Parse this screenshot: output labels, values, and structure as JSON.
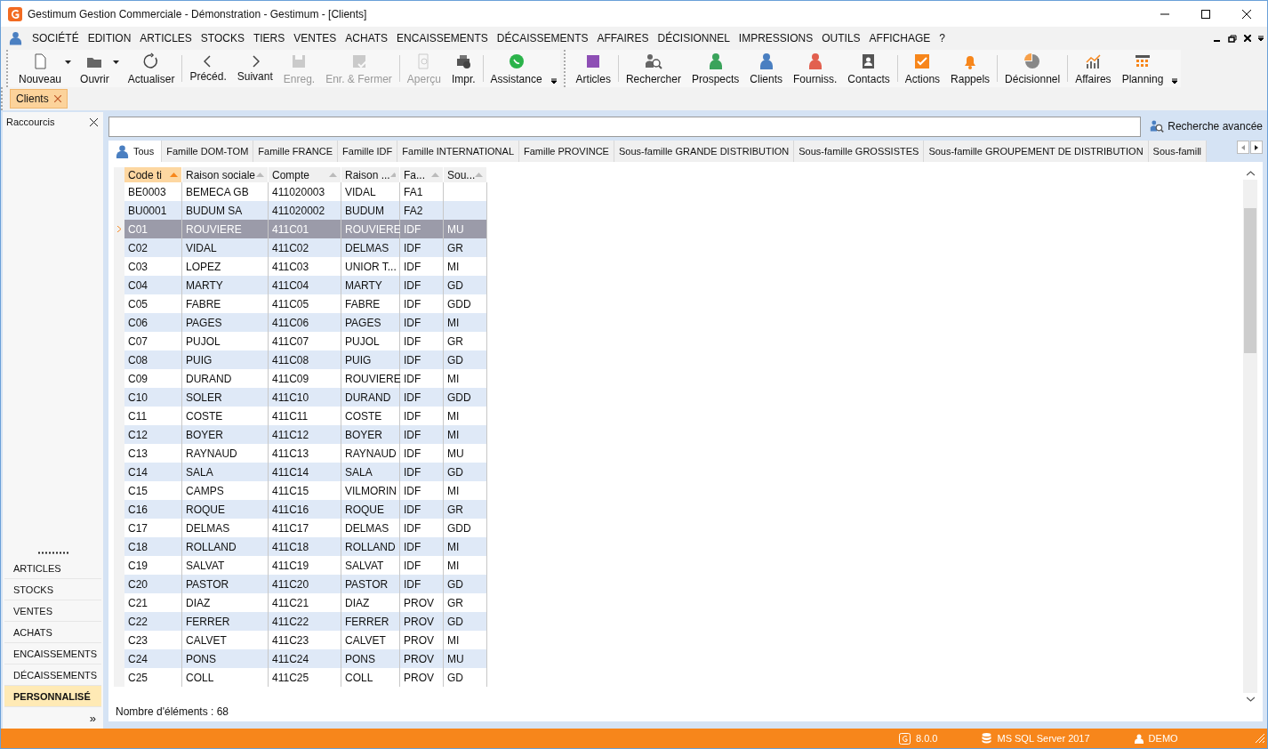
{
  "window": {
    "title": "Gestimum Gestion Commerciale - Démonstration - Gestimum - [Clients]"
  },
  "menu": [
    "SOCIÉTÉ",
    "EDITION",
    "ARTICLES",
    "STOCKS",
    "TIERS",
    "VENTES",
    "ACHATS",
    "ENCAISSEMENTS",
    "DÉCAISSEMENTS",
    "AFFAIRES",
    "DÉCISIONNEL",
    "IMPRESSIONS",
    "OUTILS",
    "AFFICHAGE",
    "?"
  ],
  "toolbars": [
    {
      "groups": [
        [
          {
            "label": "Nouveau",
            "kind": "new",
            "dropdown": true,
            "disabled": false
          },
          {
            "label": "Ouvrir",
            "kind": "folder",
            "dropdown": true,
            "disabled": false
          },
          {
            "label": "Actualiser",
            "kind": "refresh",
            "dropdown": false,
            "disabled": false
          }
        ],
        [
          {
            "label": "Précéd.",
            "kind": "prev",
            "dropdown": false,
            "disabled": false
          },
          {
            "label": "Suivant",
            "kind": "next",
            "dropdown": false,
            "disabled": false
          },
          {
            "label": "Enreg.",
            "kind": "save",
            "dropdown": false,
            "disabled": true
          },
          {
            "label": "Enr. & Fermer",
            "kind": "savecheck",
            "dropdown": false,
            "disabled": true
          }
        ],
        [
          {
            "label": "Aperçu",
            "kind": "preview",
            "dropdown": false,
            "disabled": true
          },
          {
            "label": "Impr.",
            "kind": "printer",
            "dropdown": false,
            "disabled": false
          }
        ],
        [
          {
            "label": "Assistance",
            "kind": "chat",
            "dropdown": false,
            "disabled": false
          }
        ]
      ]
    },
    {
      "groups": [
        [
          {
            "label": "Articles",
            "kind": "square",
            "dropdown": false,
            "disabled": false
          }
        ],
        [
          {
            "label": "Rechercher",
            "kind": "search",
            "dropdown": false,
            "disabled": false
          },
          {
            "label": "Prospects",
            "kind": "person",
            "color": "#3aa35b",
            "dropdown": false,
            "disabled": false
          },
          {
            "label": "Clients",
            "kind": "person",
            "color": "#4a7fc1",
            "dropdown": false,
            "disabled": false
          },
          {
            "label": "Fourniss.",
            "kind": "person",
            "color": "#e2604f",
            "dropdown": false,
            "disabled": false
          },
          {
            "label": "Contacts",
            "kind": "contacts",
            "dropdown": false,
            "disabled": false
          }
        ],
        [
          {
            "label": "Actions",
            "kind": "check",
            "dropdown": false,
            "disabled": false
          },
          {
            "label": "Rappels",
            "kind": "bell",
            "dropdown": false,
            "disabled": false
          }
        ],
        [
          {
            "label": "Décisionnel",
            "kind": "pie",
            "dropdown": false,
            "disabled": false
          }
        ],
        [
          {
            "label": "Affaires",
            "kind": "chart",
            "dropdown": false,
            "disabled": false
          },
          {
            "label": "Planning",
            "kind": "calendar",
            "dropdown": false,
            "disabled": false
          }
        ]
      ]
    }
  ],
  "document_tabs": [
    {
      "label": "Clients",
      "selected": true
    }
  ],
  "shortcuts": {
    "title": "Raccourcis",
    "items": [
      {
        "label": "ARTICLES",
        "selected": false
      },
      {
        "label": "STOCKS",
        "selected": false
      },
      {
        "label": "VENTES",
        "selected": false
      },
      {
        "label": "ACHATS",
        "selected": false
      },
      {
        "label": "ENCAISSEMENTS",
        "selected": false
      },
      {
        "label": "DÉCAISSEMENTS",
        "selected": false
      },
      {
        "label": "PERSONNALISÉ",
        "selected": true
      }
    ],
    "more": "»"
  },
  "search": {
    "button": "Recherche avancée"
  },
  "tabs": [
    {
      "label": "Tous",
      "selected": true
    },
    {
      "label": "Famille DOM-TOM",
      "selected": false
    },
    {
      "label": "Famille FRANCE",
      "selected": false
    },
    {
      "label": "Famille IDF",
      "selected": false
    },
    {
      "label": "Famille INTERNATIONAL",
      "selected": false
    },
    {
      "label": "Famille PROVINCE",
      "selected": false
    },
    {
      "label": "Sous-famille GRANDE DISTRIBUTION",
      "selected": false
    },
    {
      "label": "Sous-famille GROSSISTES",
      "selected": false
    },
    {
      "label": "Sous-famille GROUPEMENT DE DISTRIBUTION",
      "selected": false
    },
    {
      "label": "Sous-famill",
      "selected": false
    }
  ],
  "table": {
    "columns": [
      {
        "label": "Code ti",
        "sorted": true
      },
      {
        "label": "Raison sociale",
        "sorted": false
      },
      {
        "label": "Compte",
        "sorted": false
      },
      {
        "label": "Raison ...",
        "sorted": false
      },
      {
        "label": "Fa...",
        "sorted": false
      },
      {
        "label": "Sou...",
        "sorted": false
      }
    ],
    "rows": [
      {
        "cells": [
          "BE0003",
          "BEMECA GB",
          "411020003",
          "VIDAL",
          "FA1"
        ],
        "selected": false
      },
      {
        "cells": [
          "BU0001",
          "BUDUM SA",
          "411020002",
          "BUDUM",
          "FA2"
        ],
        "selected": false
      },
      {
        "cells": [
          "C01",
          "ROUVIERE",
          "411C01",
          "ROUVIERE",
          "IDF",
          "MU"
        ],
        "selected": true
      },
      {
        "cells": [
          "C02",
          "VIDAL",
          "411C02",
          "DELMAS",
          "IDF",
          "GR"
        ],
        "selected": false
      },
      {
        "cells": [
          "C03",
          "LOPEZ",
          "411C03",
          "UNIOR T...",
          "IDF",
          "MI"
        ],
        "selected": false
      },
      {
        "cells": [
          "C04",
          "MARTY",
          "411C04",
          "MARTY",
          "IDF",
          "GD"
        ],
        "selected": false
      },
      {
        "cells": [
          "C05",
          "FABRE",
          "411C05",
          "FABRE",
          "IDF",
          "GDD"
        ],
        "selected": false
      },
      {
        "cells": [
          "C06",
          "PAGES",
          "411C06",
          "PAGES",
          "IDF",
          "MI"
        ],
        "selected": false
      },
      {
        "cells": [
          "C07",
          "PUJOL",
          "411C07",
          "PUJOL",
          "IDF",
          "GR"
        ],
        "selected": false
      },
      {
        "cells": [
          "C08",
          "PUIG",
          "411C08",
          "PUIG",
          "IDF",
          "GD"
        ],
        "selected": false
      },
      {
        "cells": [
          "C09",
          "DURAND",
          "411C09",
          "ROUVIERE",
          "IDF",
          "MI"
        ],
        "selected": false
      },
      {
        "cells": [
          "C10",
          "SOLER",
          "411C10",
          "DURAND",
          "IDF",
          "GDD"
        ],
        "selected": false
      },
      {
        "cells": [
          "C11",
          "COSTE",
          "411C11",
          "COSTE",
          "IDF",
          "MI"
        ],
        "selected": false
      },
      {
        "cells": [
          "C12",
          "BOYER",
          "411C12",
          "BOYER",
          "IDF",
          "MI"
        ],
        "selected": false
      },
      {
        "cells": [
          "C13",
          "RAYNAUD",
          "411C13",
          "RAYNAUD",
          "IDF",
          "MU"
        ],
        "selected": false
      },
      {
        "cells": [
          "C14",
          "SALA",
          "411C14",
          "SALA",
          "IDF",
          "GD"
        ],
        "selected": false
      },
      {
        "cells": [
          "C15",
          "CAMPS",
          "411C15",
          "VILMORIN",
          "IDF",
          "MI"
        ],
        "selected": false
      },
      {
        "cells": [
          "C16",
          "ROQUE",
          "411C16",
          "ROQUE",
          "IDF",
          "GR"
        ],
        "selected": false
      },
      {
        "cells": [
          "C17",
          "DELMAS",
          "411C17",
          "DELMAS",
          "IDF",
          "GDD"
        ],
        "selected": false
      },
      {
        "cells": [
          "C18",
          "ROLLAND",
          "411C18",
          "ROLLAND",
          "IDF",
          "MI"
        ],
        "selected": false
      },
      {
        "cells": [
          "C19",
          "SALVAT",
          "411C19",
          "SALVAT",
          "IDF",
          "MI"
        ],
        "selected": false
      },
      {
        "cells": [
          "C20",
          "PASTOR",
          "411C20",
          "PASTOR",
          "IDF",
          "GD"
        ],
        "selected": false
      },
      {
        "cells": [
          "C21",
          "DIAZ",
          "411C21",
          "DIAZ",
          "PROV",
          "GR"
        ],
        "selected": false
      },
      {
        "cells": [
          "C22",
          "FERRER",
          "411C22",
          "FERRER",
          "PROV",
          "GD"
        ],
        "selected": false
      },
      {
        "cells": [
          "C23",
          "CALVET",
          "411C23",
          "CALVET",
          "PROV",
          "MI"
        ],
        "selected": false
      },
      {
        "cells": [
          "C24",
          "PONS",
          "411C24",
          "PONS",
          "PROV",
          "MU"
        ],
        "selected": false
      },
      {
        "cells": [
          "C25",
          "COLL",
          "411C25",
          "COLL",
          "PROV",
          "GD"
        ],
        "selected": false
      }
    ]
  },
  "item_count": "Nombre d'éléments : 68",
  "status_bar": {
    "version": "8.0.0",
    "database": "MS SQL Server 2017",
    "user": "DEMO"
  }
}
